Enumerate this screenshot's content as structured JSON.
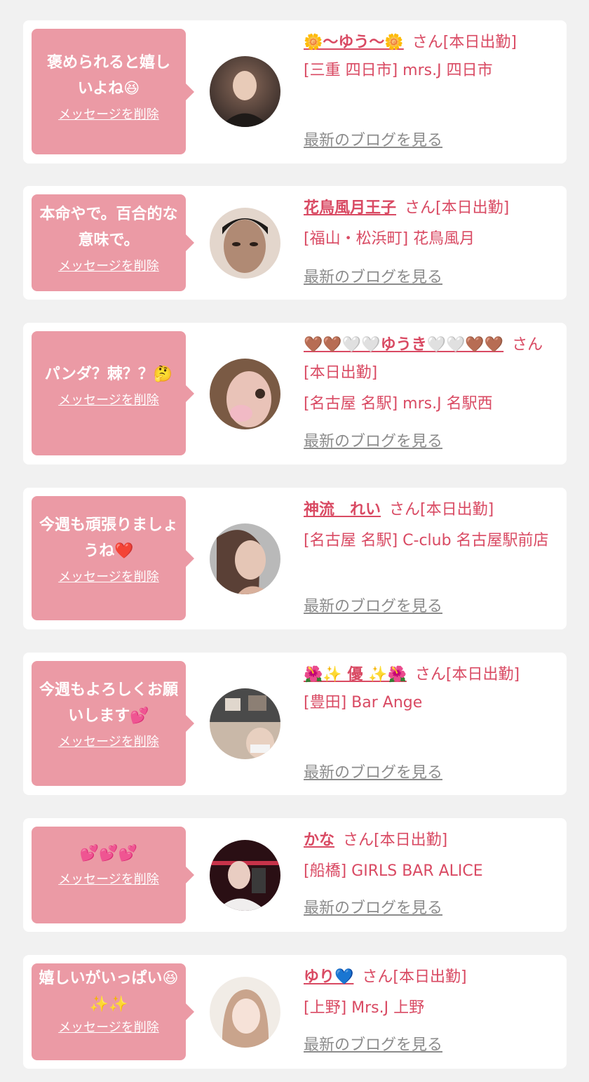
{
  "items": [
    {
      "message": "褒められると嬉しいよね😆",
      "delete_label": "メッセージを削除",
      "name": "🌼〜ゆう〜🌼",
      "suffix": "さん[本日出勤]",
      "shop": "[三重 四日市] mrs.J 四日市",
      "blog_label": "最新のブログを見る",
      "avatar_colors": [
        "#3a2e2a",
        "#8a6a5a"
      ]
    },
    {
      "message": "本命やで。百合的な意味で。",
      "delete_label": "メッセージを削除",
      "name": "花鳥風月王子",
      "suffix": "さん[本日出勤]",
      "shop": "[福山・松浜町] 花鳥風月",
      "blog_label": "最新のブログを見る",
      "avatar_colors": [
        "#1d1a18",
        "#b08a74"
      ]
    },
    {
      "message": "パンダ？棘？？🤔",
      "delete_label": "メッセージを削除",
      "name": "🤎🤎🤍🤍ゆうき🤍🤍🤎🤎",
      "suffix": "さん[本日出勤]",
      "shop": "[名古屋 名駅] mrs.J 名駅西",
      "blog_label": "最新のブログを見る",
      "avatar_colors": [
        "#7a5a44",
        "#e9c3b8"
      ]
    },
    {
      "message": "今週も頑張りましょうね❤️",
      "delete_label": "メッセージを削除",
      "name": "神流　れい",
      "suffix": "さん[本日出勤]",
      "shop": "[名古屋 名駅] C-club 名古屋駅前店",
      "blog_label": "最新のブログを見る",
      "avatar_colors": [
        "#b9b9b9",
        "#5a4036"
      ]
    },
    {
      "message": "今週もよろしくお願いします💕",
      "delete_label": "メッセージを削除",
      "name": "🌺✨ 優 ✨🌺",
      "suffix": "さん[本日出勤]",
      "shop": "[豊田] Bar Ange",
      "blog_label": "最新のブログを見る",
      "avatar_colors": [
        "#4a4a4a",
        "#c9b8a8"
      ]
    },
    {
      "message": "💕💕💕",
      "delete_label": "メッセージを削除",
      "name": "かな",
      "suffix": "さん[本日出勤]",
      "shop": "[船橋] GIRLS BAR ALICE",
      "blog_label": "最新のブログを見る",
      "avatar_colors": [
        "#2a0f14",
        "#c7334a"
      ]
    },
    {
      "message": "嬉しいがいっぱい😆✨✨",
      "delete_label": "メッセージを削除",
      "name": "ゆり💙",
      "suffix": "さん[本日出勤]",
      "shop": "[上野] Mrs.J 上野",
      "blog_label": "最新のブログを見る",
      "avatar_colors": [
        "#f1ece6",
        "#c9a48c"
      ]
    }
  ]
}
